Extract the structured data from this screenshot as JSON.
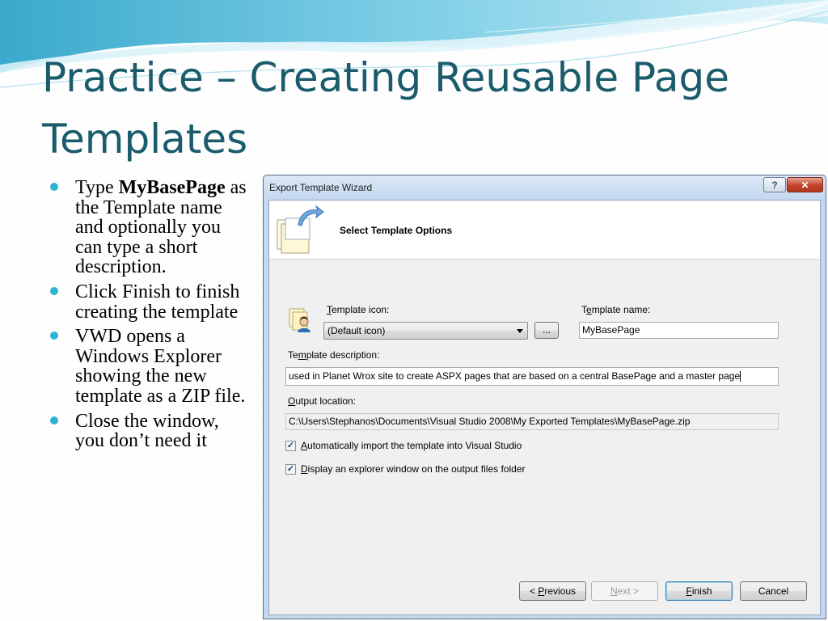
{
  "slide": {
    "title": "Practice – Creating Reusable Page Templates",
    "bullets": [
      {
        "before": "Type ",
        "bold": "MyBasePage",
        "after": " as the Template name and optionally you can type a short description."
      },
      {
        "text": "Click Finish to finish creating the template"
      },
      {
        "text": "VWD opens a Windows Explorer showing the  new template as a ZIP file."
      },
      {
        "text": "Close the window, you don’t need it"
      }
    ],
    "accent_color": "#2eb3d3",
    "title_color": "#1a5c6c"
  },
  "dialog": {
    "title": "Export Template Wizard",
    "help_label": "?",
    "close_label": "✕",
    "header": "Select Template Options",
    "template_icon": {
      "label_u": "T",
      "label_rest": "emplate icon:",
      "value": "(Default icon)",
      "browse_label": "..."
    },
    "template_name": {
      "label_pre": "T",
      "label_u": "e",
      "label_rest": "mplate name:",
      "value": "MyBasePage"
    },
    "template_description": {
      "label_pre": "Te",
      "label_u": "m",
      "label_rest": "plate description:",
      "value": "used in Planet Wrox site to create ASPX pages that are based on a central BasePage and a master page"
    },
    "output_location": {
      "label_u": "O",
      "label_rest": "utput location:",
      "value": "C:\\Users\\Stephanos\\Documents\\Visual Studio 2008\\My Exported Templates\\MyBasePage.zip"
    },
    "options": [
      {
        "u": "A",
        "rest": "utomatically import the template into Visual Studio",
        "checked": true
      },
      {
        "u": "D",
        "rest": "isplay an explorer window on the output files folder",
        "checked": true
      }
    ],
    "buttons": {
      "previous": {
        "pre": "< ",
        "u": "P",
        "rest": "revious"
      },
      "next": {
        "pre": "",
        "u": "N",
        "rest": "ext >"
      },
      "finish": {
        "pre": "",
        "u": "F",
        "rest": "inish"
      },
      "cancel": "Cancel"
    }
  }
}
